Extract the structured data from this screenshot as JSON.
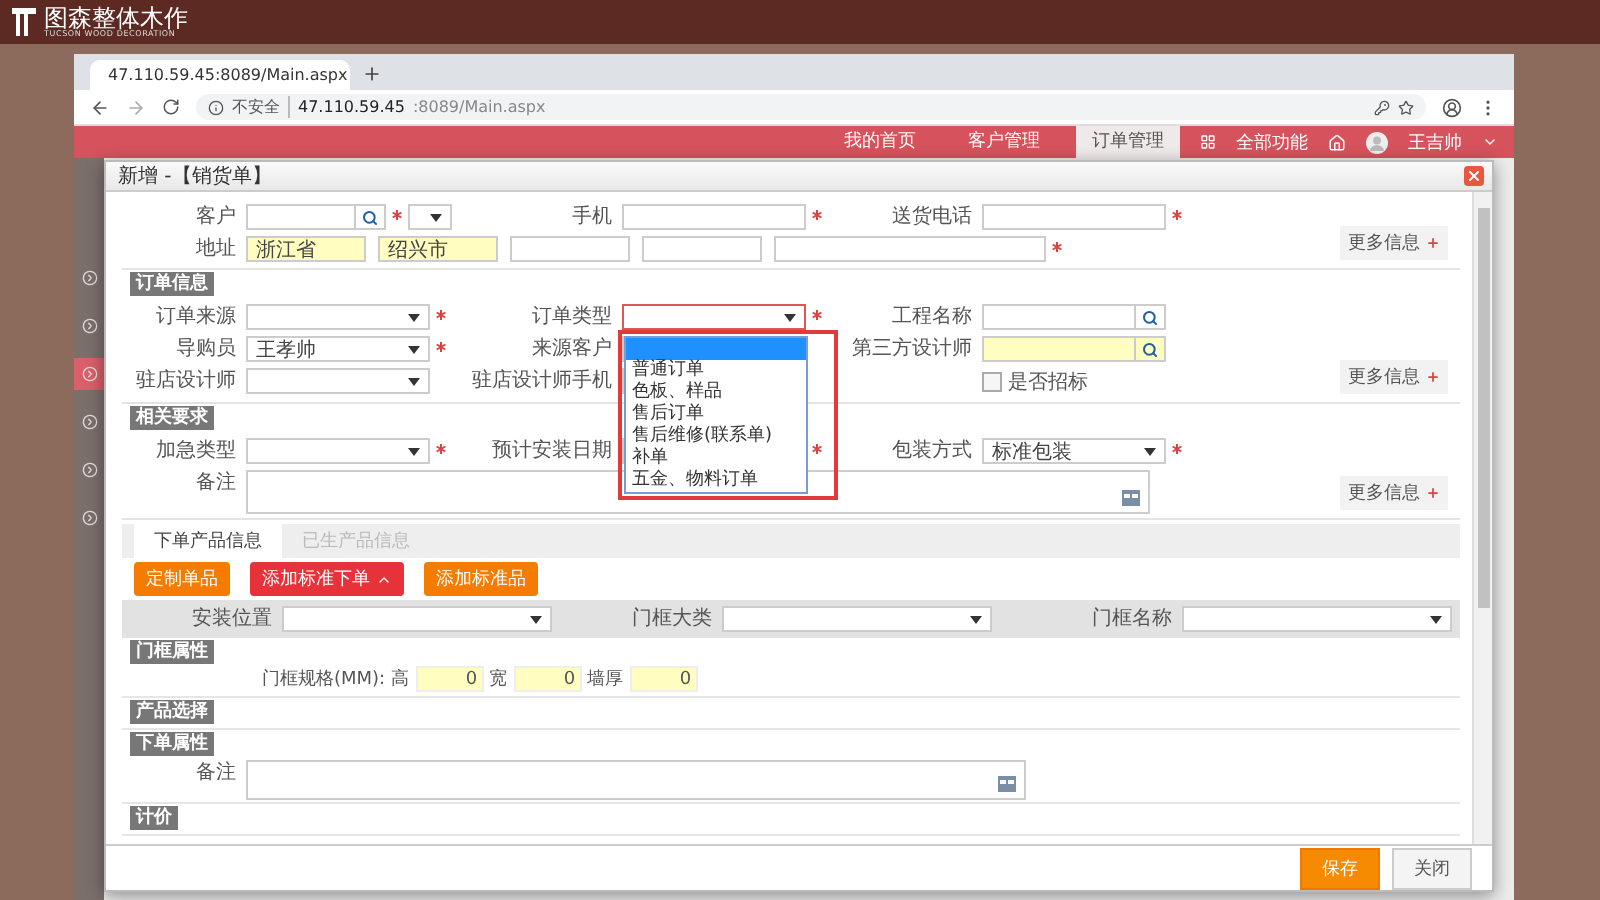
{
  "brand": {
    "name": "图森整体木作",
    "tagline": "TUCSON WOOD DECORATION"
  },
  "browser": {
    "tab_title": "47.110.59.45:8089/Main.aspx",
    "security_label": "不安全",
    "url_host": "47.110.59.45",
    "url_path": ":8089/Main.aspx"
  },
  "app_header": {
    "nav": [
      {
        "label": "我的首页",
        "selected": false
      },
      {
        "label": "客户管理",
        "selected": false
      },
      {
        "label": "订单管理",
        "selected": true
      }
    ],
    "all_functions": "全部功能",
    "user": "王吉帅"
  },
  "sidebar": {
    "items": [
      {
        "selected": false
      },
      {
        "selected": false
      },
      {
        "selected": true
      },
      {
        "selected": false
      },
      {
        "selected": false
      },
      {
        "selected": false
      }
    ]
  },
  "dialog": {
    "title": "新增 -【销货单】",
    "groups": [
      {
        "rows": [
          {
            "fields": [
              {
                "label": "客户",
                "kind": "combo",
                "required": true,
                "highlighted": false
              },
              {
                "label": "手机",
                "kind": "text",
                "required": true,
                "highlighted": false
              },
              {
                "label": "送货电话",
                "kind": "text",
                "required": true,
                "highlighted": false
              }
            ]
          },
          {
            "fields": [
              {
                "label": "地址",
                "kind": "address",
                "required": true,
                "parts": [
                  {
                    "value": "浙江省",
                    "highlighted": true
                  },
                  {
                    "value": "绍兴市",
                    "highlighted": true
                  },
                  {
                    "highlighted": false
                  },
                  {
                    "highlighted": false
                  },
                  {
                    "highlighted": false
                  }
                ]
              }
            ]
          }
        ],
        "more": "更多信息"
      },
      {
        "heading": "订单信息",
        "rows": [
          {
            "fields": [
              {
                "label": "订单来源",
                "kind": "select",
                "required": true,
                "highlighted": false
              },
              {
                "label": "订单类型",
                "kind": "select",
                "required": true,
                "highlighted": false,
                "open": true,
                "dropdown": {
                  "blank_selected": true,
                  "highlight_box": true,
                  "options": [
                    {
                      "label": "普通订单",
                      "selected": false
                    },
                    {
                      "label": "色板、样品",
                      "selected": false
                    },
                    {
                      "label": "售后订单",
                      "selected": false
                    },
                    {
                      "label": "售后维修(联系单)",
                      "selected": false
                    },
                    {
                      "label": "补单",
                      "selected": false
                    },
                    {
                      "label": "五金、物料订单",
                      "selected": false
                    }
                  ]
                }
              },
              {
                "label": "工程名称",
                "kind": "lookup",
                "required": false,
                "highlighted": false
              }
            ]
          },
          {
            "fields": [
              {
                "label": "导购员",
                "kind": "select",
                "required": true,
                "highlighted": false,
                "value": "王孝帅"
              },
              {
                "label": "来源客户",
                "kind": "text",
                "required": false
              },
              {
                "label": "第三方设计师",
                "kind": "lookup",
                "required": false,
                "highlighted": true
              }
            ]
          },
          {
            "fields": [
              {
                "label": "驻店设计师",
                "kind": "select",
                "required": false,
                "highlighted": false
              },
              {
                "label": "驻店设计师手机",
                "kind": "text",
                "required": false
              },
              {
                "label": "是否招标",
                "kind": "checkbox",
                "checked": false
              }
            ]
          }
        ],
        "more": "更多信息"
      },
      {
        "heading": "相关要求",
        "rows": [
          {
            "fields": [
              {
                "label": "加急类型",
                "kind": "select",
                "required": true,
                "highlighted": false
              },
              {
                "label": "预计安装日期",
                "kind": "text",
                "required": true
              },
              {
                "label": "包装方式",
                "kind": "select",
                "required": true,
                "highlighted": false,
                "value": "标准包装"
              }
            ]
          },
          {
            "fields": [
              {
                "label": "备注",
                "kind": "textarea",
                "required": false,
                "highlighted": false
              }
            ]
          }
        ],
        "more": "更多信息"
      }
    ],
    "tabs": [
      {
        "label": "下单产品信息",
        "selected": true
      },
      {
        "label": "已生产品信息",
        "selected": false
      }
    ],
    "actions": [
      {
        "label": "定制单品",
        "color": "#f57c00",
        "expanded": false
      },
      {
        "label": "添加标准下单",
        "color": "#e8323a",
        "expanded": true
      },
      {
        "label": "添加标准品",
        "color": "#f57c00",
        "expanded": false
      }
    ],
    "filters": [
      {
        "label": "安装位置"
      },
      {
        "label": "门框大类"
      },
      {
        "label": "门框名称"
      }
    ],
    "sections": [
      {
        "heading": "门框属性",
        "kind": "dimensions",
        "label": "门框规格(MM):",
        "fields": [
          {
            "label": "高",
            "value": "0"
          },
          {
            "label": "宽",
            "value": "0"
          },
          {
            "label": "墙厚",
            "value": "0"
          }
        ]
      },
      {
        "heading": "产品选择",
        "kind": "empty"
      },
      {
        "heading": "下单属性",
        "kind": "notes",
        "label": "备注"
      },
      {
        "heading": "计价",
        "kind": "empty"
      }
    ],
    "footer": [
      {
        "label": "保存",
        "kind": "primary"
      },
      {
        "label": "关闭",
        "kind": "secondary"
      }
    ]
  }
}
